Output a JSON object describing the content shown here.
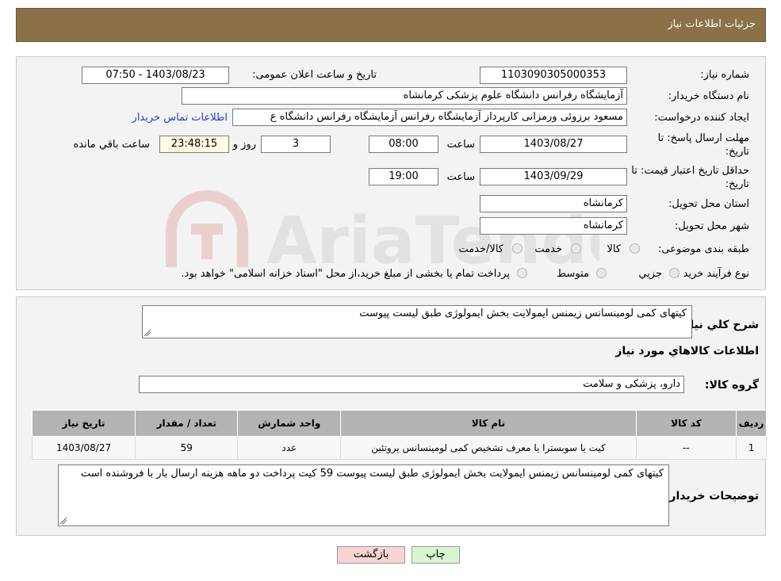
{
  "header": {
    "title": "جزئیات اطلاعات نیاز"
  },
  "details": {
    "need_number_label": "شماره نیاز:",
    "need_number": "1103090305000353",
    "announce_label": "تاریخ و ساعت اعلان عمومی:",
    "announce_value": "1403/08/23 - 07:50",
    "buyer_org_label": "نام دستگاه خریدار:",
    "buyer_org": "آزمایشگاه رفرانس دانشگاه علوم پزشکی کرمانشاه",
    "requester_label": "ایجاد کننده درخواست:",
    "requester": "مسعود برزوئی ورمزانی کارپرداز آزمایشگاه رفرانس آزمایشگاه رفرانس دانشگاه ع",
    "contact_link": "اطلاعات تماس خریدار",
    "reply_deadline_label_1": "مهلت ارسال پاسخ: تا",
    "reply_deadline_label_2": "تاریخ:",
    "reply_date": "1403/08/27",
    "time_label": "ساعت",
    "reply_time": "08:00",
    "days_value": "3",
    "days_label": "روز و",
    "remaining_time": "23:48:15",
    "remaining_label": "ساعت باقي مانده",
    "validity_label_1": "حداقل تاریخ اعتبار قیمت: تا",
    "validity_label_2": "تاریخ:",
    "validity_date": "1403/09/29",
    "validity_time": "19:00",
    "province_label": "استان محل تحویل:",
    "province": "کرمانشاه",
    "city_label": "شهر محل تحویل:",
    "city": "کرمانشاه",
    "category_label": "طبقه بندی موضوعی:",
    "category_options": [
      "کالا",
      "خدمت",
      "کالا/خدمت"
    ],
    "process_label": "نوع فرآیند خرید :",
    "process_options": [
      "جزیي",
      "متوسط"
    ],
    "process_note": "پرداخت تمام یا بخشی از مبلغ خرید،از محل \"اسناد خزانه اسلامی\" خواهد بود."
  },
  "summary": {
    "description_label": "شرح کلي نیاز:",
    "description": "کیتهای کمی لومینسانس زیمنس ایمولایت بخش ایمولوژی طبق لیست پیوست",
    "goods_info_title": "اطلاعات کالاهاي مورد نیاز",
    "goods_group_label": "گروه کالا:",
    "goods_group": "دارو، پزشکی و سلامت",
    "table": {
      "headers": [
        "ردیف",
        "کد کالا",
        "نام کالا",
        "واحد شمارش",
        "تعداد / مقدار",
        "تاریخ نیاز"
      ],
      "rows": [
        [
          "1",
          "--",
          "کیت یا سوبسترا یا معرف تشخیص کمی لومینسانس پروتئین",
          "عدد",
          "59",
          "1403/08/27"
        ]
      ]
    },
    "buyer_notes_label": "توضیحات خریدار:",
    "buyer_notes": "کیتهای کمی لومینسانس زیمنس ایمولایت بخش ایمولوژی طبق لیست پیوست 59 کیت پرداخت دو ماهه هزینه ارسال بار با فروشنده است"
  },
  "buttons": {
    "print": "چاپ",
    "back": "بازگشت"
  },
  "colors": {
    "header_bg": "#8b7147",
    "link": "#1a3fd6",
    "back_btn": "#f7d3d3",
    "print_btn": "#d9f5d0"
  }
}
